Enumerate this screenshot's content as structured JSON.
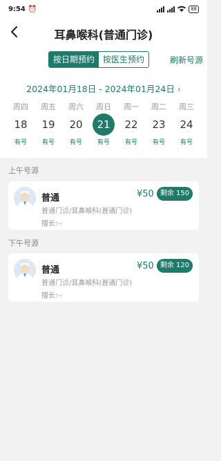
{
  "status_bar": {
    "time": "9:54",
    "battery": "88"
  },
  "header": {
    "title": "耳鼻喉科(普通门诊)"
  },
  "toggle": {
    "by_date": "按日期预约",
    "by_doctor": "按医生预约"
  },
  "refresh_label": "刷新号源",
  "date_range": "2024年01月18日 - 2024年01月24日",
  "days": [
    {
      "weekday": "周四",
      "date": "18",
      "status": "有号",
      "selected": false
    },
    {
      "weekday": "周五",
      "date": "19",
      "status": "有号",
      "selected": false
    },
    {
      "weekday": "周六",
      "date": "20",
      "status": "有号",
      "selected": false
    },
    {
      "weekday": "周日",
      "date": "21",
      "status": "有号",
      "selected": true
    },
    {
      "weekday": "周一",
      "date": "22",
      "status": "有号",
      "selected": false
    },
    {
      "weekday": "周二",
      "date": "23",
      "status": "有号",
      "selected": false
    },
    {
      "weekday": "周三",
      "date": "24",
      "status": "有号",
      "selected": false
    }
  ],
  "morning": {
    "label": "上午号源",
    "card": {
      "name": "普通",
      "dept": "普通门诊/耳鼻喉科(普通门诊)",
      "specialty": "擅长:--",
      "price": "¥50",
      "remaining": "剩余 150"
    }
  },
  "afternoon": {
    "label": "下午号源",
    "card": {
      "name": "普通",
      "dept": "普通门诊/耳鼻喉科(普通门诊)",
      "specialty": "擅长:--",
      "price": "¥50",
      "remaining": "剩余 120"
    }
  },
  "colors": {
    "accent": "#1f7a6a",
    "arrow": "#e04040",
    "background": "#f2f2f2"
  }
}
